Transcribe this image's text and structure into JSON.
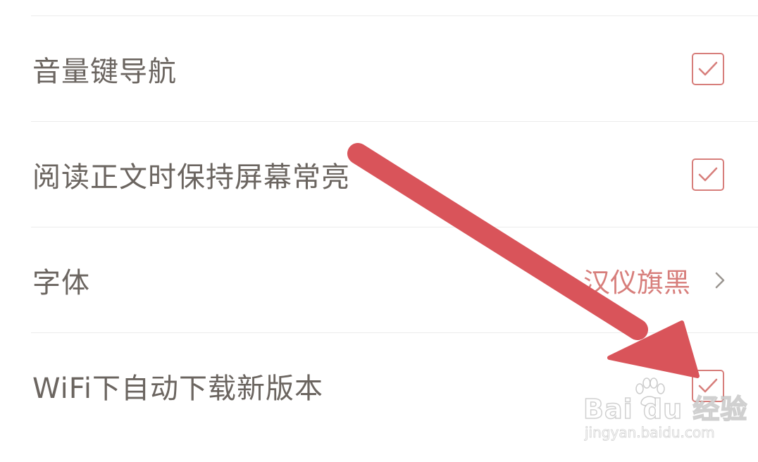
{
  "settings": {
    "rows": [
      {
        "label": "音量键导航",
        "control": "checkbox",
        "checked": true
      },
      {
        "label": "阅读正文时保持屏幕常亮",
        "control": "checkbox",
        "checked": true
      },
      {
        "label": "字体",
        "control": "disclosure",
        "value": "汉仪旗黑"
      },
      {
        "label": "WiFi下自动下载新版本",
        "control": "checkbox",
        "checked": true
      }
    ]
  },
  "colors": {
    "accent": "#d77e7b",
    "label_text": "#6b6560",
    "divider": "#ececec",
    "annotation_arrow": "#d9545a"
  },
  "icons": {
    "check": "checkmark-icon",
    "chevron": "chevron-right-icon",
    "arrow": "annotation-arrow",
    "watermark_logo": "baidu-paw-icon"
  },
  "watermark": {
    "main": "Bai du 经验",
    "sub": "jingyan.baidu.com"
  }
}
